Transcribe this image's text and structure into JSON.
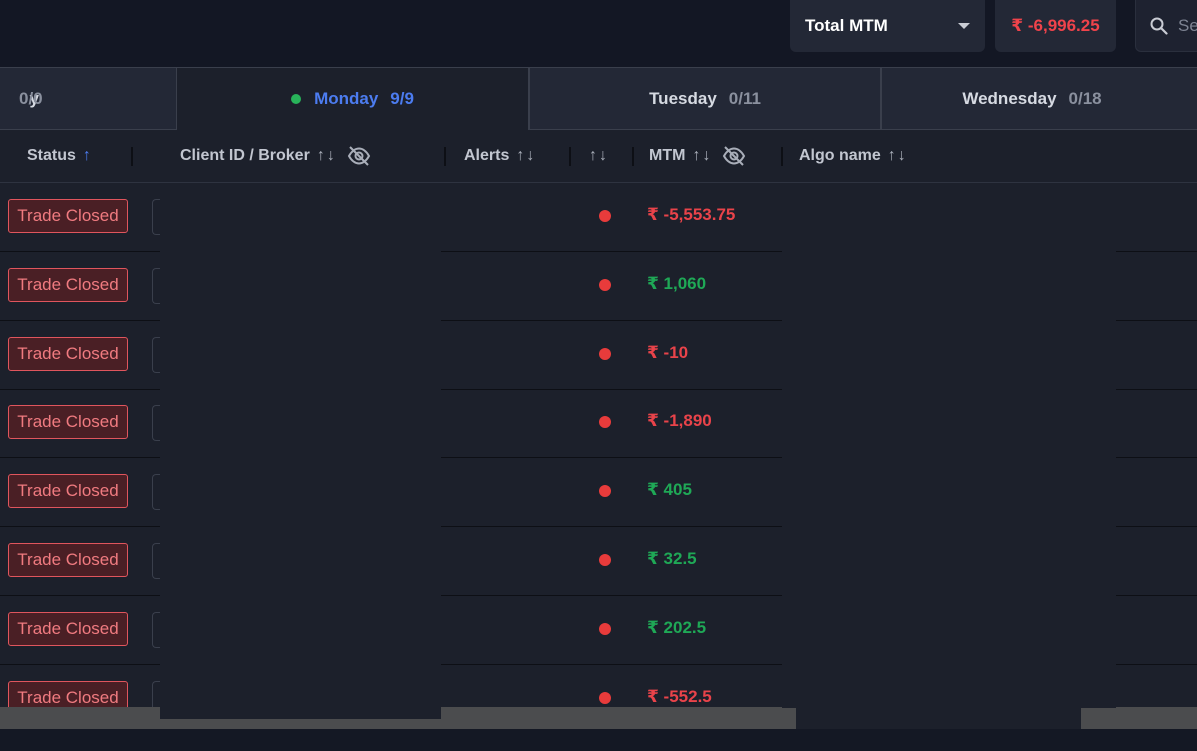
{
  "topbar": {
    "mtm_selector_label": "Total MTM",
    "total_mtm_value": "₹ -6,996.25",
    "search_placeholder": "Se"
  },
  "tabs": [
    {
      "label": "y",
      "count": "0/0"
    },
    {
      "label": "Monday",
      "count": "9/9",
      "active": true
    },
    {
      "label": "Tuesday",
      "count": "0/11"
    },
    {
      "label": "Wednesday",
      "count": "0/18"
    }
  ],
  "columns": {
    "status": "Status",
    "client": "Client ID / Broker",
    "alerts": "Alerts",
    "mtm": "MTM",
    "algo": "Algo name"
  },
  "rows": [
    {
      "status": "Trade Closed",
      "mtm": "₹ -5,553.75",
      "sign": "neg"
    },
    {
      "status": "Trade Closed",
      "mtm": "₹ 1,060",
      "sign": "pos"
    },
    {
      "status": "Trade Closed",
      "mtm": "₹ -10",
      "sign": "neg"
    },
    {
      "status": "Trade Closed",
      "mtm": "₹ -1,890",
      "sign": "neg"
    },
    {
      "status": "Trade Closed",
      "mtm": "₹ 405",
      "sign": "pos"
    },
    {
      "status": "Trade Closed",
      "mtm": "₹ 32.5",
      "sign": "pos"
    },
    {
      "status": "Trade Closed",
      "mtm": "₹ 202.5",
      "sign": "pos"
    },
    {
      "status": "Trade Closed",
      "mtm": "₹ -552.5",
      "sign": "neg"
    }
  ],
  "colors": {
    "accent": "#4c7cf0",
    "negative": "#e9434a",
    "positive": "#1fa856",
    "alert_dot": "#e83b3b"
  }
}
